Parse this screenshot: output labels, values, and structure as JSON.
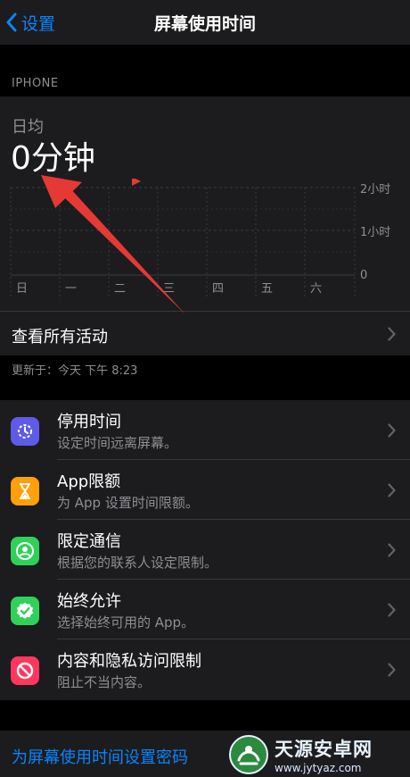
{
  "nav": {
    "back_label": "设置",
    "title": "屏幕使用时间"
  },
  "section_header": "IPHONE",
  "summary": {
    "avg_label": "日均",
    "avg_value": "0分钟",
    "y_labels": [
      "2小时",
      "1小时",
      "0"
    ],
    "day_labels": [
      "日",
      "一",
      "二",
      "三",
      "四",
      "五",
      "六"
    ],
    "daily_usage_minutes": [
      0,
      0,
      0,
      0,
      0,
      0,
      0
    ],
    "see_all_label": "查看所有活动"
  },
  "updated_text": "更新于：今天 下午 8:23",
  "settings": [
    {
      "title": "停用时间",
      "subtitle": "设定时间远离屏幕。",
      "icon": "downtime-icon",
      "color": "#5e5ce6"
    },
    {
      "title": "App限额",
      "subtitle": "为 App 设置时间限额。",
      "icon": "hourglass-icon",
      "color": "#ff9f0a"
    },
    {
      "title": "限定通信",
      "subtitle": "根据您的联系人设定限制。",
      "icon": "contact-icon",
      "color": "#30d158"
    },
    {
      "title": "始终允许",
      "subtitle": "选择始终可用的 App。",
      "icon": "checkmark-icon",
      "color": "#30d158"
    },
    {
      "title": "内容和隐私访问限制",
      "subtitle": "阻止不当内容。",
      "icon": "restriction-icon",
      "color": "#ff375f"
    }
  ],
  "passcode_label": "为屏幕使用时间设置密码",
  "watermark": {
    "name": "天源安卓网",
    "url": "www.jytyaz.com"
  },
  "colors": {
    "accent": "#0a84ff",
    "arrow": "#e53935",
    "background": "#000000",
    "cell": "#1c1c1e"
  }
}
